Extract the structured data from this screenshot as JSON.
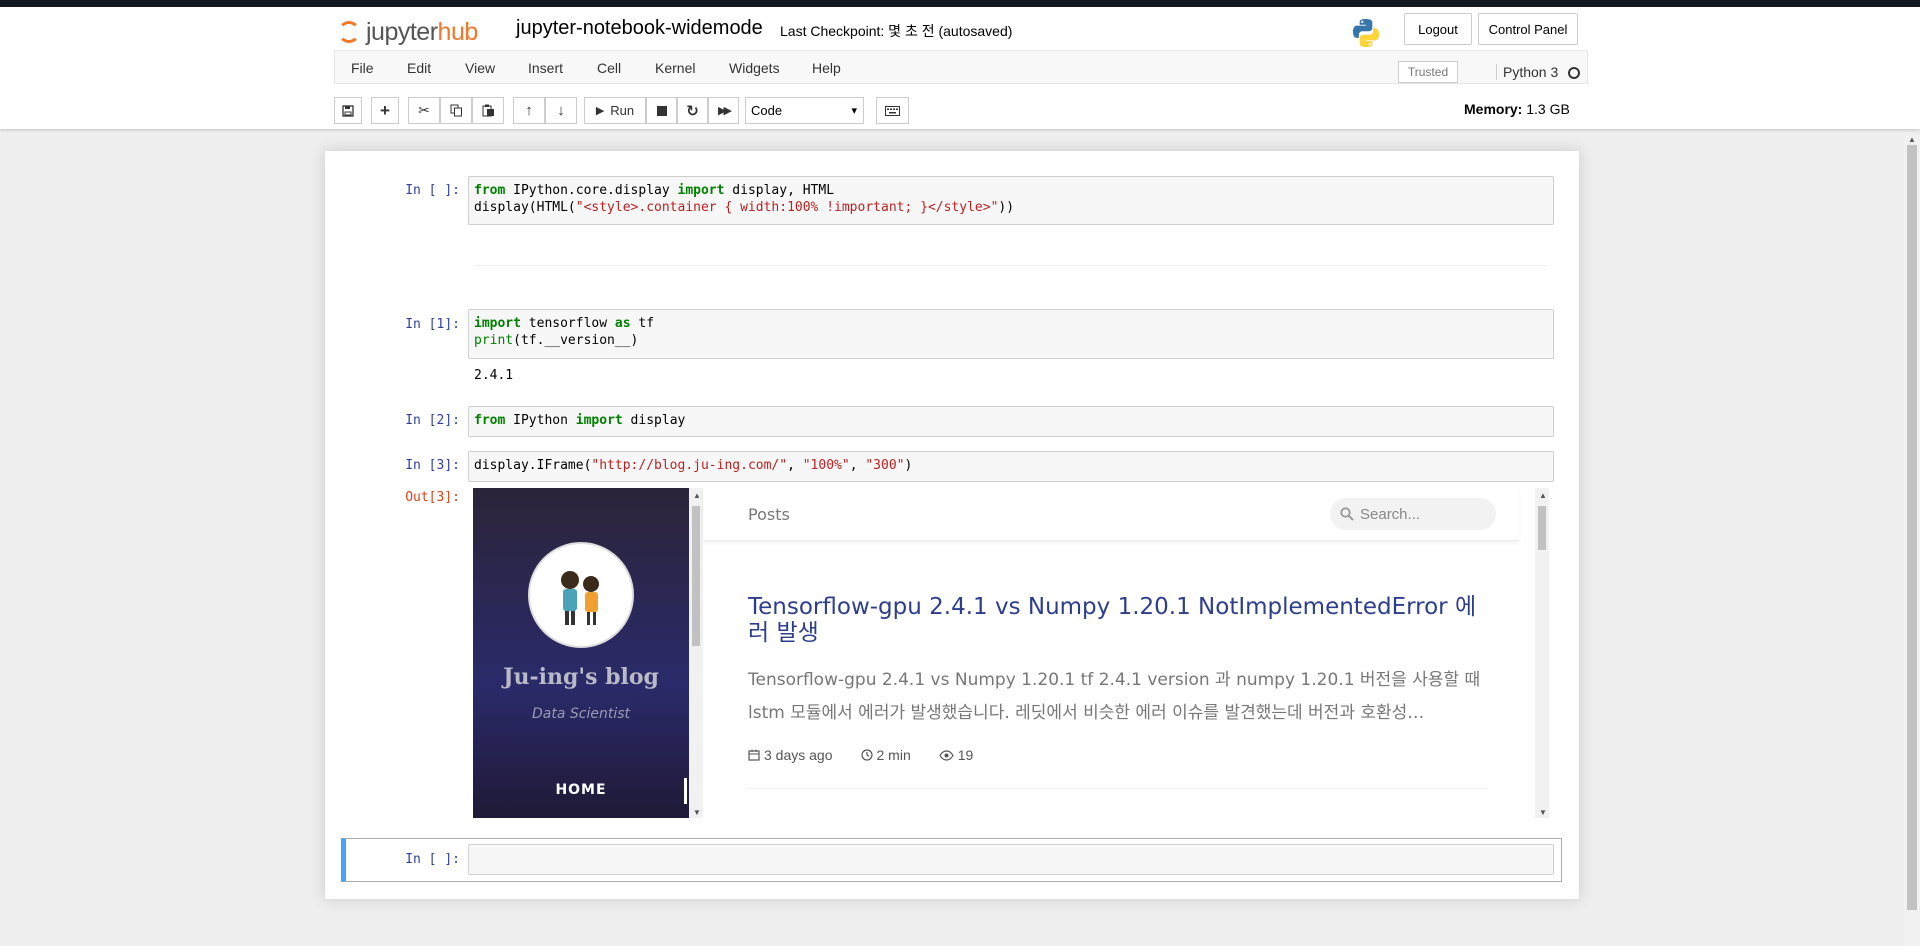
{
  "header": {
    "logo_text_1": "jupyter",
    "logo_text_2": "hub",
    "notebook_name": "jupyter-notebook-widemode",
    "checkpoint": "Last Checkpoint: 몇 초 전  (autosaved)",
    "logout_label": "Logout",
    "control_panel_label": "Control Panel"
  },
  "menu": {
    "items": [
      "File",
      "Edit",
      "View",
      "Insert",
      "Cell",
      "Kernel",
      "Widgets",
      "Help"
    ],
    "trusted": "Trusted",
    "kernel_name": "Python 3"
  },
  "toolbar": {
    "run_label": "Run",
    "cell_type": "Code",
    "memory_label": "Memory:",
    "memory_value": "1.3 GB"
  },
  "cells": [
    {
      "prompt": "In [ ]:",
      "lines": [
        [
          {
            "t": "from",
            "c": "kw"
          },
          {
            "t": " IPython.core.display ",
            "c": ""
          },
          {
            "t": "import",
            "c": "kw"
          },
          {
            "t": " display, HTML",
            "c": ""
          }
        ],
        [
          {
            "t": "display(HTML(",
            "c": ""
          },
          {
            "t": "\"<style>.container { width:100% !important; }</style>\"",
            "c": "st"
          },
          {
            "t": "))",
            "c": ""
          }
        ]
      ]
    },
    {
      "prompt": "In [1]:",
      "lines": [
        [
          {
            "t": "import",
            "c": "kw"
          },
          {
            "t": " tensorflow ",
            "c": ""
          },
          {
            "t": "as",
            "c": "kw"
          },
          {
            "t": " tf",
            "c": ""
          }
        ],
        [
          {
            "t": "print",
            "c": "bi"
          },
          {
            "t": "(tf.__version__)",
            "c": ""
          }
        ]
      ],
      "output": "2.4.1"
    },
    {
      "prompt": "In [2]:",
      "lines": [
        [
          {
            "t": "from",
            "c": "kw"
          },
          {
            "t": " IPython ",
            "c": ""
          },
          {
            "t": "import",
            "c": "kw"
          },
          {
            "t": " display",
            "c": ""
          }
        ]
      ]
    },
    {
      "prompt": "In [3]:",
      "lines": [
        [
          {
            "t": "display.IFrame(",
            "c": ""
          },
          {
            "t": "\"http://blog.ju-ing.com/\"",
            "c": "st"
          },
          {
            "t": ", ",
            "c": ""
          },
          {
            "t": "\"100%\"",
            "c": "st"
          },
          {
            "t": ", ",
            "c": ""
          },
          {
            "t": "\"300\"",
            "c": "st"
          },
          {
            "t": ")",
            "c": ""
          }
        ]
      ],
      "out_prompt": "Out[3]:"
    },
    {
      "prompt": "In [ ]:",
      "lines": []
    }
  ],
  "blog": {
    "title": "Ju-ing's blog",
    "subtitle": "Data Scientist",
    "home_label": "HOME",
    "posts_label": "Posts",
    "search_placeholder": "Search...",
    "post_title": "Tensorflow-gpu 2.4.1 vs Numpy 1.20.1 NotImplementedError 에러 발생",
    "post_excerpt": "Tensorflow-gpu 2.4.1 vs Numpy 1.20.1 tf 2.4.1 version 과 numpy 1.20.1 버전을 사용할 때 lstm 모듈에서 에러가 발생했습니다. 레딧에서 비슷한 에러 이슈를 발견했는데 버전과 호환성…",
    "post_date": "3 days ago",
    "post_read_time": "2 min",
    "post_views": "19"
  },
  "colors": {
    "jupyter_orange": "#f37726",
    "prompt_in": "#303f9f",
    "prompt_out": "#d84315",
    "keyword": "#008000",
    "string": "#ba2121",
    "selected_cell": "#42a5f5",
    "post_title": "#2d3e8c"
  }
}
